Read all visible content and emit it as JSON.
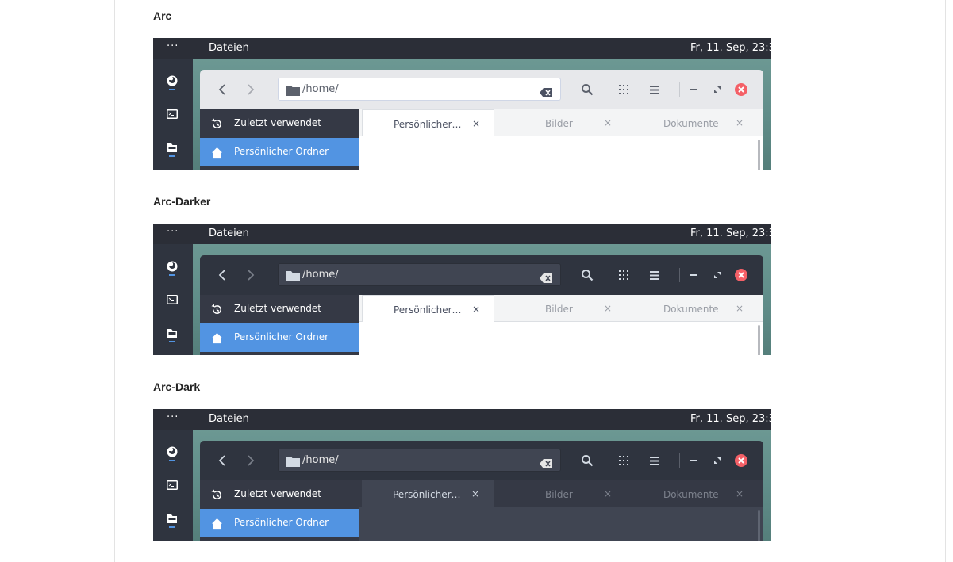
{
  "colors": {
    "accent": "#5294e2",
    "close_button": "#f46067",
    "topbar": "#2b2e37",
    "dock": "#2f343f"
  },
  "themes": [
    {
      "heading": "Arc",
      "topbar": {
        "menu": "···",
        "app": "Dateien",
        "clock": "Fr, 11. Sep, 23:3"
      },
      "path": "/home/",
      "places": [
        "Zuletzt verwendet",
        "Persönlicher Ordner"
      ],
      "tabs": [
        {
          "label": "Persönlicher…",
          "close": "×"
        },
        {
          "label": "Bilder",
          "close": "×"
        },
        {
          "label": "Dokumente",
          "close": "×"
        }
      ]
    },
    {
      "heading": "Arc-Darker",
      "topbar": {
        "menu": "···",
        "app": "Dateien",
        "clock": "Fr, 11. Sep, 23:3"
      },
      "path": "/home/",
      "places": [
        "Zuletzt verwendet",
        "Persönlicher Ordner"
      ],
      "tabs": [
        {
          "label": "Persönlicher…",
          "close": "×"
        },
        {
          "label": "Bilder",
          "close": "×"
        },
        {
          "label": "Dokumente",
          "close": "×"
        }
      ]
    },
    {
      "heading": "Arc-Dark",
      "topbar": {
        "menu": "···",
        "app": "Dateien",
        "clock": "Fr, 11. Sep, 23:3"
      },
      "path": "/home/",
      "places": [
        "Zuletzt verwendet",
        "Persönlicher Ordner"
      ],
      "tabs": [
        {
          "label": "Persönlicher…",
          "close": "×"
        },
        {
          "label": "Bilder",
          "close": "×"
        },
        {
          "label": "Dokumente",
          "close": "×"
        }
      ]
    }
  ],
  "icons": {
    "dock": [
      "firefox-icon",
      "terminal-icon",
      "files-icon"
    ],
    "header": [
      "back-icon",
      "forward-icon",
      "folder-icon",
      "clear-icon",
      "search-icon",
      "grid-view-icon",
      "menu-icon",
      "minimize-icon",
      "maximize-icon",
      "close-icon"
    ],
    "places": [
      "recent-icon",
      "home-icon"
    ]
  }
}
